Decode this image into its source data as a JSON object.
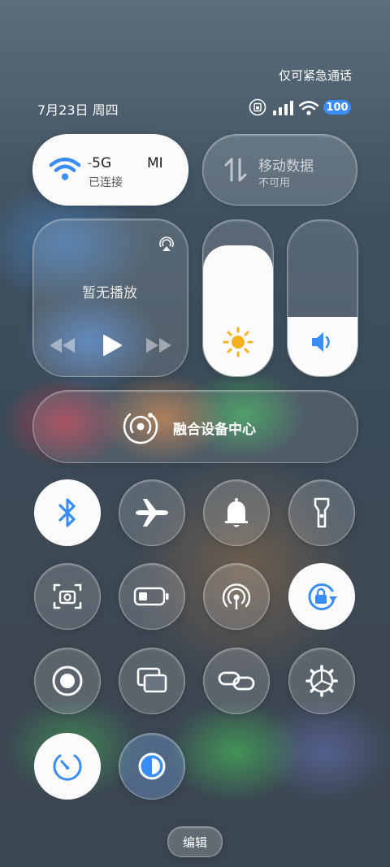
{
  "status_bar": {
    "carrier_text": "仅可紧急通话",
    "date": "7月23日 周四",
    "battery": "100"
  },
  "wifi_card": {
    "network_name": "-5G",
    "network_name_suffix": "MI",
    "status": "已连接"
  },
  "mobile_data_card": {
    "title": "移动数据",
    "status": "不可用"
  },
  "media_card": {
    "status": "暂无播放"
  },
  "brightness_slider": {
    "level": 0.84
  },
  "volume_slider": {
    "level": 0.38
  },
  "device_center": {
    "label": "融合设备中心"
  },
  "edit_button": {
    "label": "编辑"
  },
  "colors": {
    "accent_blue": "#3a8df5",
    "sun_yellow": "#f5b21c"
  }
}
